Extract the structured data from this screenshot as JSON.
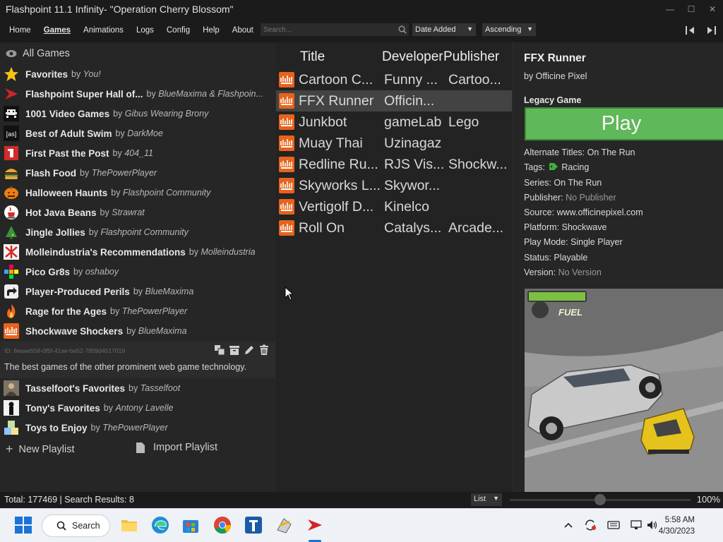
{
  "window": {
    "title": "Flashpoint 11.1 Infinity- \"Operation Cherry Blossom\"",
    "controls": [
      "—",
      "☐",
      "✕"
    ]
  },
  "menu": {
    "items": [
      "Home",
      "Games",
      "Animations",
      "Logs",
      "Config",
      "Help",
      "About"
    ],
    "active": "Games",
    "search_placeholder": "Search...",
    "sort_field": "Date Added",
    "sort_direction": "Ascending"
  },
  "sidebar": {
    "all_games": "All Games",
    "playlists": [
      {
        "name": "Favorites",
        "by": "by",
        "author": "You!",
        "icon": "star-icon"
      },
      {
        "name": "Flashpoint Super Hall of...",
        "by": "by",
        "author": "BlueMaxima & Flashpoin...",
        "icon": "flashpoint-logo-icon"
      },
      {
        "name": "1001 Video Games",
        "by": "by",
        "author": "Gibus Wearing Brony",
        "icon": "space-invader-icon"
      },
      {
        "name": "Best of Adult Swim",
        "by": "by",
        "author": "DarkMoe",
        "icon": "adult-swim-icon"
      },
      {
        "name": "First Past the Post",
        "by": "by",
        "author": "404_11",
        "icon": "first-place-icon"
      },
      {
        "name": "Flash Food",
        "by": "by",
        "author": "ThePowerPlayer",
        "icon": "burger-icon"
      },
      {
        "name": "Halloween Haunts",
        "by": "by",
        "author": "Flashpoint Community",
        "icon": "pumpkin-icon"
      },
      {
        "name": "Hot Java Beans",
        "by": "by",
        "author": "Strawrat",
        "icon": "java-cup-icon"
      },
      {
        "name": "Jingle Jollies",
        "by": "by",
        "author": "Flashpoint Community",
        "icon": "christmas-tree-icon"
      },
      {
        "name": "Molleindustria's Recommendations",
        "by": "by",
        "author": "Molleindustria",
        "icon": "molleindustria-icon"
      },
      {
        "name": "Pico Gr8s",
        "by": "by",
        "author": "oshaboy",
        "icon": "pico-8-icon"
      },
      {
        "name": "Player-Produced Perils",
        "by": "by",
        "author": "BlueMaxima",
        "icon": "share-arrow-icon"
      },
      {
        "name": "Rage for the Ages",
        "by": "by",
        "author": "ThePowerPlayer",
        "icon": "flame-icon"
      },
      {
        "name": "Shockwave Shockers",
        "by": "by",
        "author": "BlueMaxima",
        "icon": "shockwave-icon"
      },
      {
        "name": "Tasselfoot's Favorites",
        "by": "by",
        "author": "Tasselfoot",
        "icon": "tasselfoot-avatar-icon"
      },
      {
        "name": "Tony's Favorites",
        "by": "by",
        "author": "Antony Lavelle",
        "icon": "tony-avatar-icon"
      },
      {
        "name": "Toys to Enjoy",
        "by": "by",
        "author": "ThePowerPlayer",
        "icon": "toy-blocks-icon"
      }
    ],
    "selected_playlist": {
      "id": "ID: 8eaae558-0f5f-41ae-ba52-7859d4517019",
      "description": "The best games of the other prominent web game technology."
    },
    "new_playlist": "New Playlist",
    "import_playlist": "Import Playlist"
  },
  "game_list": {
    "headers": [
      "Title",
      "Developer",
      "Publisher"
    ],
    "rows": [
      {
        "title": "Cartoon C...",
        "developer": "Funny ...",
        "publisher": "Cartoo...",
        "selected": false
      },
      {
        "title": "FFX Runner",
        "developer": "Officin...",
        "publisher": "",
        "selected": true
      },
      {
        "title": "Junkbot",
        "developer": "gameLab",
        "publisher": "Lego",
        "selected": false
      },
      {
        "title": "Muay Thai",
        "developer": "Uzinagaz",
        "publisher": "",
        "selected": false
      },
      {
        "title": "Redline Ru...",
        "developer": "RJS Vis...",
        "publisher": "Shockw...",
        "selected": false
      },
      {
        "title": "Skyworks L...",
        "developer": "Skywor...",
        "publisher": "",
        "selected": false
      },
      {
        "title": "Vertigolf D...",
        "developer": "Kinelco",
        "publisher": "",
        "selected": false
      },
      {
        "title": "Roll On",
        "developer": "Catalys...",
        "publisher": "Arcade...",
        "selected": false
      }
    ]
  },
  "detail": {
    "title": "FFX Runner",
    "by": "by Officine Pixel",
    "legacy": "Legacy Game",
    "play": "Play",
    "fields": [
      {
        "label": "Alternate Titles:",
        "value": "On The Run",
        "muted": false
      },
      {
        "label": "Tags:",
        "value": "Racing",
        "muted": false,
        "tag": true
      },
      {
        "label": "Series:",
        "value": "On The Run",
        "muted": false
      },
      {
        "label": "Publisher:",
        "value": "No Publisher",
        "muted": true
      },
      {
        "label": "Source:",
        "value": "www.officinepixel.com",
        "muted": false
      },
      {
        "label": "Platform:",
        "value": "Shockwave",
        "muted": false
      },
      {
        "label": "Play Mode:",
        "value": "Single Player",
        "muted": false
      },
      {
        "label": "Status:",
        "value": "Playable",
        "muted": false
      },
      {
        "label": "Version:",
        "value": "No Version",
        "muted": true
      }
    ],
    "screenshot_hud": "FUEL"
  },
  "status": {
    "info": "Total: 177469  |  Search Results: 8",
    "view_mode": "List",
    "zoom": "100%",
    "zoom_level": 0.5
  },
  "taskbar": {
    "search_label": "Search",
    "time": "5:58 AM",
    "date": "4/30/2023"
  },
  "colors": {
    "play_green": "#5fb85a",
    "shockwave_orange": "#e8631c",
    "selection_gray": "#434343"
  }
}
